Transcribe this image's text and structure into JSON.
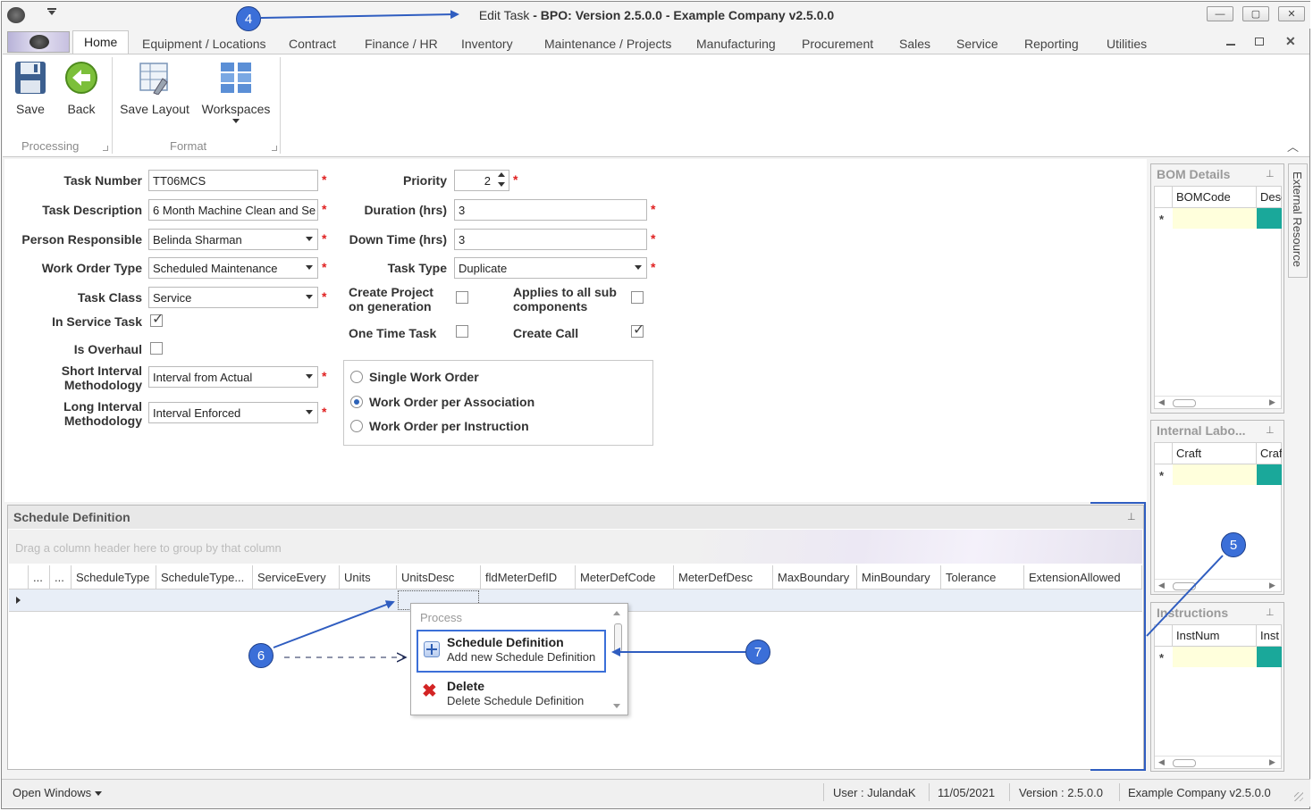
{
  "window": {
    "title_prefix": "Edit Task",
    "title_rest": " - BPO: Version 2.5.0.0 - Example Company v2.5.0.0",
    "min": "—",
    "restore": "▢",
    "close": "✕"
  },
  "ribbon": {
    "tabs": [
      "Home",
      "Equipment / Locations",
      "Contract",
      "Finance / HR",
      "Inventory",
      "Maintenance / Projects",
      "Manufacturing",
      "Procurement",
      "Sales",
      "Service",
      "Reporting",
      "Utilities"
    ],
    "buttons": {
      "save": "Save",
      "back": "Back",
      "save_layout": "Save Layout",
      "workspaces": "Workspaces"
    },
    "groups": {
      "processing": "Processing",
      "format": "Format"
    }
  },
  "form": {
    "task_number": {
      "label": "Task Number",
      "value": "TT06MCS"
    },
    "task_description": {
      "label": "Task Description",
      "value": "6 Month Machine Clean and Se"
    },
    "person_responsible": {
      "label": "Person Responsible",
      "value": "Belinda Sharman"
    },
    "work_order_type": {
      "label": "Work Order Type",
      "value": "Scheduled Maintenance"
    },
    "task_class": {
      "label": "Task Class",
      "value": "Service"
    },
    "in_service_task": {
      "label": "In Service Task",
      "checked": true
    },
    "is_overhaul": {
      "label": "Is Overhaul",
      "checked": false
    },
    "short_interval": {
      "label1": "Short Interval",
      "label2": "Methodology",
      "value": "Interval from Actual"
    },
    "long_interval": {
      "label1": "Long Interval",
      "label2": "Methodology",
      "value": "Interval Enforced"
    },
    "priority": {
      "label": "Priority",
      "value": "2"
    },
    "duration": {
      "label": "Duration (hrs)",
      "value": "3"
    },
    "down_time": {
      "label": "Down Time (hrs)",
      "value": "3"
    },
    "task_type": {
      "label": "Task Type",
      "value": "Duplicate"
    },
    "create_project": {
      "label1": "Create Project",
      "label2": "on generation",
      "checked": false
    },
    "applies_sub": {
      "label1": "Applies to all sub",
      "label2": "components",
      "checked": false
    },
    "one_time_task": {
      "label": "One Time Task",
      "checked": false
    },
    "create_call": {
      "label": "Create Call",
      "checked": true
    },
    "work_order_options": [
      {
        "label": "Single Work Order",
        "selected": false
      },
      {
        "label": "Work Order per Association",
        "selected": true
      },
      {
        "label": "Work Order per Instruction",
        "selected": false
      }
    ]
  },
  "schedule": {
    "title": "Schedule Definition",
    "group_hint": "Drag a column header here to group by that column",
    "columns": [
      "...",
      "...",
      "ScheduleType",
      "ScheduleType...",
      "ServiceEvery",
      "Units",
      "UnitsDesc",
      "fldMeterDefID",
      "MeterDefCode",
      "MeterDefDesc",
      "MaxBoundary",
      "MinBoundary",
      "Tolerance",
      "ExtensionAllowed"
    ]
  },
  "context_menu": {
    "header": "Process",
    "items": [
      {
        "title": "Schedule Definition",
        "subtitle": "Add new Schedule Definition"
      },
      {
        "title": "Delete",
        "subtitle": "Delete Schedule Definition"
      }
    ]
  },
  "side_panels": [
    {
      "title": "BOM Details",
      "col1": "BOMCode",
      "col2": "Desc"
    },
    {
      "title": "Internal Labo...",
      "col1": "Craft",
      "col2": "Craf"
    },
    {
      "title": "Instructions",
      "col1": "InstNum",
      "col2": "Inst"
    }
  ],
  "external_tab": "External Resource",
  "status": {
    "open_windows": "Open Windows",
    "user": "User : JulandaK",
    "date": "11/05/2021",
    "version": "Version : 2.5.0.0",
    "company": "Example Company v2.5.0.0"
  },
  "callouts": [
    "4",
    "5",
    "6",
    "7"
  ],
  "colors": {
    "accent": "#3b6fd8",
    "required": "#e02020",
    "new_row_yellow": "#ffffdc",
    "teal": "#1aa89a"
  }
}
